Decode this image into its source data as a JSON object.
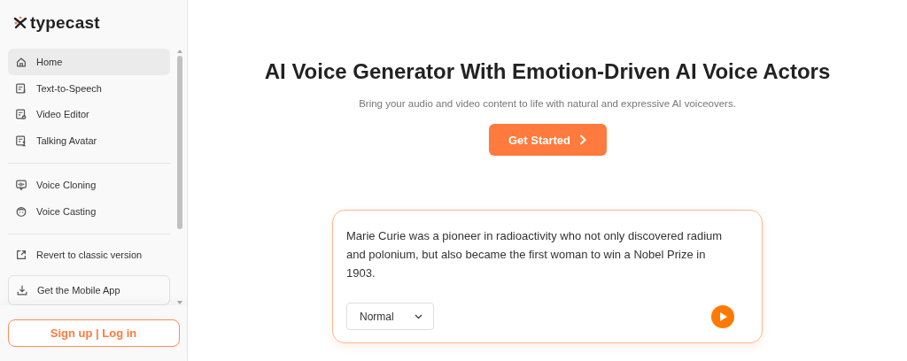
{
  "logo": {
    "text": "typecast"
  },
  "nav": [
    {
      "label": "Home",
      "selected": true
    },
    {
      "label": "Text-to-Speech",
      "selected": false
    },
    {
      "label": "Video Editor",
      "selected": false
    },
    {
      "label": "Talking Avatar",
      "selected": false
    }
  ],
  "nav2": [
    {
      "label": "Voice Cloning",
      "selected": false
    },
    {
      "label": "Voice Casting",
      "selected": false
    }
  ],
  "revert_link": "Revert to classic version",
  "mobile_app_button": "Get the Mobile App",
  "auth_button": "Sign up | Log in",
  "hero": {
    "title": "AI Voice Generator With Emotion-Driven AI Voice Actors",
    "subtitle": "Bring your audio and video content to life with natural and expressive AI voiceovers.",
    "cta": "Get Started"
  },
  "demo": {
    "text": "Marie Curie was a pioneer in radioactivity who not only discovered radium and polonium, but also became the first woman to win a Nobel Prize in 1903.",
    "style_select": "Normal"
  }
}
